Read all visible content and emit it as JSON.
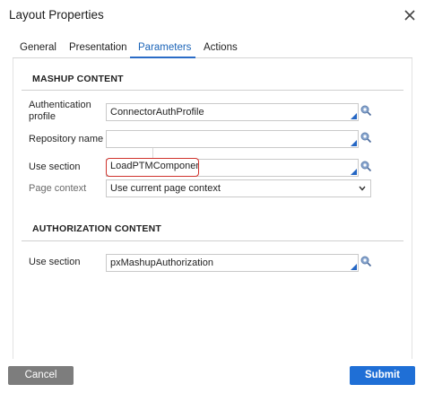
{
  "dialog": {
    "title": "Layout Properties",
    "close_icon": "close-icon"
  },
  "tabs": [
    {
      "label": "General",
      "active": false
    },
    {
      "label": "Presentation",
      "active": false
    },
    {
      "label": "Parameters",
      "active": true
    },
    {
      "label": "Actions",
      "active": false
    }
  ],
  "mashup": {
    "header": "MASHUP CONTENT",
    "auth_profile": {
      "label": "Authentication profile",
      "label_line1": "Authentication",
      "label_line2": "profile",
      "value": "ConnectorAuthProfile"
    },
    "repository": {
      "label": "Repository name",
      "value": ""
    },
    "use_section": {
      "label": "Use section",
      "value": "LoadPTMComponent"
    },
    "page_context": {
      "label": "Page context",
      "value": "Use current page context"
    }
  },
  "authorization": {
    "header": "AUTHORIZATION CONTENT",
    "use_section": {
      "label": "Use section",
      "value": "pxMashupAuthorization"
    }
  },
  "footer": {
    "cancel_label": "Cancel",
    "submit_label": "Submit"
  },
  "colors": {
    "accent": "#1f6fd6",
    "highlight": "#d0322c",
    "cancel": "#7d7d7d"
  }
}
